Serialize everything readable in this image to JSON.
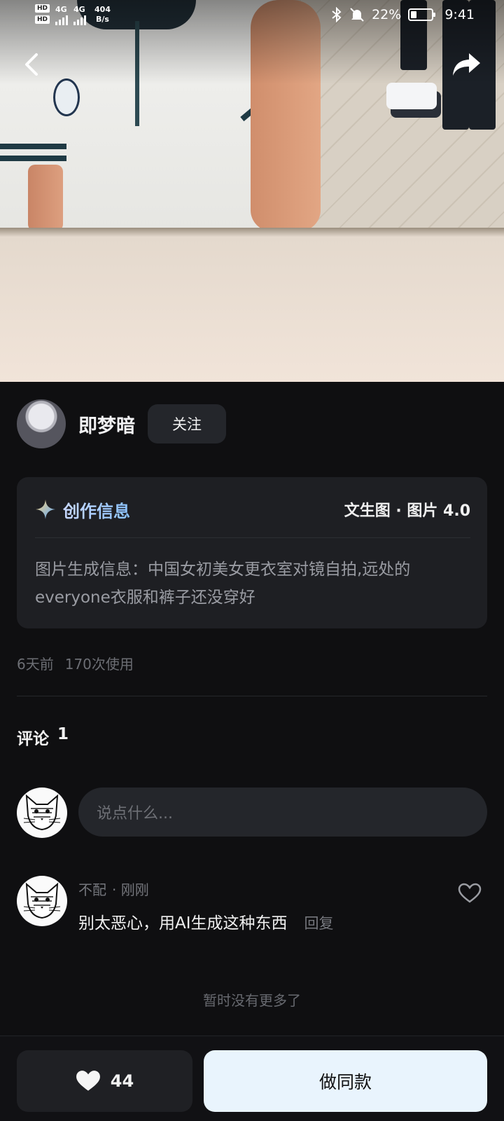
{
  "status_bar": {
    "hd1": "HD",
    "hd2": "HD",
    "signal1_label": "4G",
    "signal2_label": "4G",
    "net_speed_value": "404",
    "net_speed_unit": "B/s",
    "icons": [
      "bluetooth-icon",
      "mute-icon",
      "battery-icon"
    ],
    "battery": "22%",
    "time": "9:41"
  },
  "nav": {
    "back_icon": "back-icon",
    "share_icon": "share-icon"
  },
  "author": {
    "name": "即梦暗",
    "follow_label": "关注"
  },
  "info_card": {
    "title": "创作信息",
    "meta": "文生图 · 图片 4.0",
    "prompt": "图片生成信息：中国女初美女更衣室对镜自拍,远处的everyone衣服和裤子还没穿好"
  },
  "stats": {
    "time_ago": "6天前",
    "uses": "170次使用"
  },
  "comments": {
    "label": "评论",
    "count": "1",
    "input_placeholder": "说点什么...",
    "items": [
      {
        "user": "不配",
        "time": "· 刚刚",
        "text": "别太恶心，用AI生成这种东西",
        "reply_label": "回复"
      }
    ],
    "end_text": "暂时没有更多了"
  },
  "bottom_bar": {
    "like_count": "44",
    "make_same_label": "做同款"
  },
  "colors": {
    "background": "#0f0f11",
    "card": "#1e1f23",
    "primary_button": "#e9f4fd",
    "accent": "#8ac2ff"
  }
}
